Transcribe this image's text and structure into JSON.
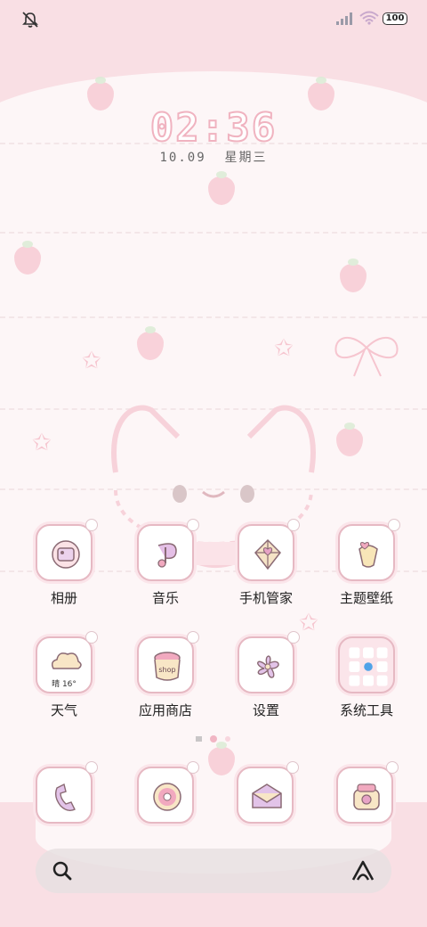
{
  "status_bar": {
    "left_icon": "mute-notification-icon",
    "battery": "100"
  },
  "lockclock": {
    "time": "02:36",
    "date": "10.09",
    "weekday": "星期三"
  },
  "apps": [
    {
      "label": "相册",
      "icon": "photo-album-icon"
    },
    {
      "label": "音乐",
      "icon": "music-note-icon"
    },
    {
      "label": "手机管家",
      "icon": "shield-heart-icon"
    },
    {
      "label": "主题壁纸",
      "icon": "theme-brush-icon"
    },
    {
      "label": "天气",
      "icon": "cloud-weather-icon",
      "temp": "晴 16°"
    },
    {
      "label": "应用商店",
      "icon": "shop-jar-icon",
      "shop_text": "shop"
    },
    {
      "label": "设置",
      "icon": "flower-gear-icon"
    },
    {
      "label": "系统工具",
      "icon": "folder-tools-icon"
    }
  ],
  "dock": [
    {
      "icon": "phone-icon"
    },
    {
      "icon": "donut-messages-icon"
    },
    {
      "icon": "envelope-icon"
    },
    {
      "icon": "camera-bag-icon"
    }
  ],
  "colors": {
    "accent_pink": "#f0b3c0",
    "band_pink": "#f9dfe4",
    "background": "#fdf6f7"
  }
}
